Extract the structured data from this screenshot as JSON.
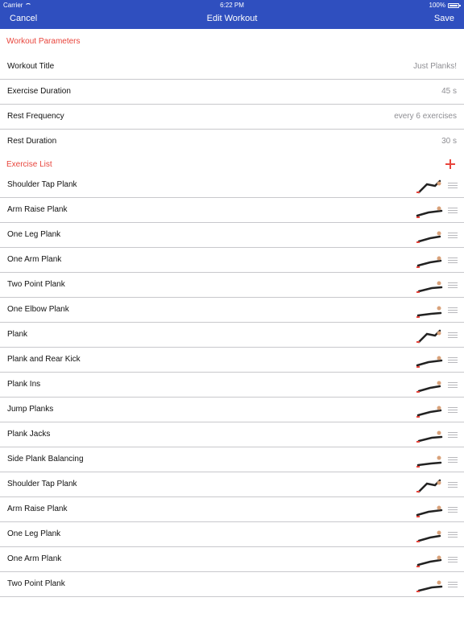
{
  "status": {
    "carrier": "Carrier",
    "time": "6:22 PM",
    "battery": "100%"
  },
  "nav": {
    "cancel": "Cancel",
    "title": "Edit Workout",
    "save": "Save"
  },
  "params": {
    "header": "Workout Parameters",
    "rows": [
      {
        "label": "Workout Title",
        "value": "Just Planks!"
      },
      {
        "label": "Exercise Duration",
        "value": "45 s"
      },
      {
        "label": "Rest Frequency",
        "value": "every 6 exercises"
      },
      {
        "label": "Rest Duration",
        "value": "30 s"
      }
    ]
  },
  "exercises": {
    "header": "Exercise List",
    "add_icon": "plus-icon",
    "items": [
      "Shoulder Tap Plank",
      "Arm Raise Plank",
      "One Leg Plank",
      "One Arm Plank",
      "Two Point Plank",
      "One Elbow Plank",
      "Plank",
      "Plank and Rear Kick",
      "Plank Ins",
      "Jump Planks",
      "Plank Jacks",
      "Side Plank Balancing",
      "Shoulder Tap Plank",
      "Arm Raise Plank",
      "One Leg Plank",
      "One Arm Plank",
      "Two Point Plank"
    ]
  },
  "colors": {
    "nav_bg": "#2f4fbf",
    "accent": "#e8453c",
    "separator": "#c8c8cc",
    "value_gray": "#8e8e93"
  }
}
